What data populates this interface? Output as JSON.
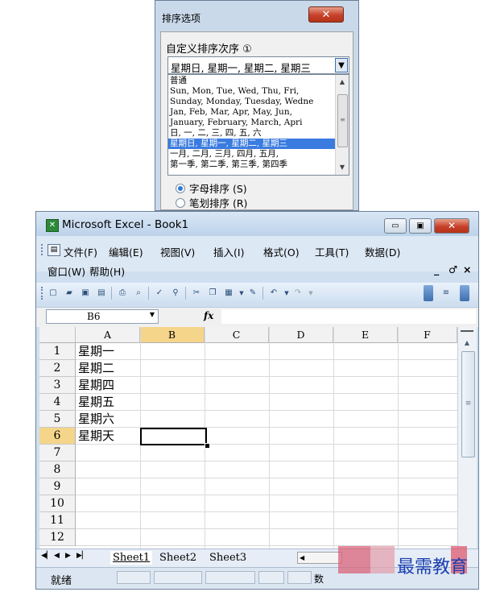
{
  "sort_dialog": {
    "title": "排序选项",
    "close_glyph": "✕",
    "custom_order_label": "自定义排序次序 ①",
    "combo_value": "星期日, 星期一, 星期二, 星期三",
    "list_items": [
      "普通",
      "Sun, Mon, Tue, Wed, Thu, Fri,",
      "Sunday, Monday, Tuesday, Wedne",
      "Jan, Feb, Mar, Apr, May, Jun,",
      "January, February, March, Apri",
      "日, 一, 二, 三, 四, 五, 六",
      "星期日, 星期一, 星期二, 星期三",
      "一月, 二月, 三月, 四月, 五月,",
      "第一季, 第二季, 第三季, 第四季"
    ],
    "selected_index": 6,
    "radio_alpha": "字母排序 (S)",
    "radio_stroke": "笔划排序 (R)"
  },
  "excel": {
    "app_title": "Microsoft Excel - Book1",
    "window_buttons": {
      "minimize": "▭",
      "maximize": "▣",
      "close": "✕"
    },
    "menu_row1": [
      "文件(F)",
      "编辑(E)",
      "视图(V)",
      "插入(I)",
      "格式(O)",
      "工具(T)",
      "数据(D)"
    ],
    "menu_row2": [
      "窗口(W)",
      "帮助(H)"
    ],
    "mdi_controls": [
      "_",
      "♂",
      "×"
    ],
    "name_box": "B6",
    "fx_label": "fx",
    "columns": [
      "A",
      "B",
      "C",
      "D",
      "E",
      "F"
    ],
    "active_column": "B",
    "rows": [
      "1",
      "2",
      "3",
      "4",
      "5",
      "6",
      "7",
      "8",
      "9",
      "10",
      "11",
      "12"
    ],
    "active_row": "6",
    "cells_a": [
      "星期一",
      "星期二",
      "星期四",
      "星期五",
      "星期六",
      "星期天"
    ],
    "sheet_tabs": [
      "Sheet1",
      "Sheet2",
      "Sheet3"
    ],
    "active_sheet": "Sheet1",
    "status": "就绪",
    "status_num": "数"
  },
  "watermark": "最需教育",
  "colors": {
    "dialog_frame": "#c9d9ea",
    "selection_blue": "#3a7be0",
    "active_header": "#f5d58a",
    "watermark_text": "#1a3fb0"
  }
}
